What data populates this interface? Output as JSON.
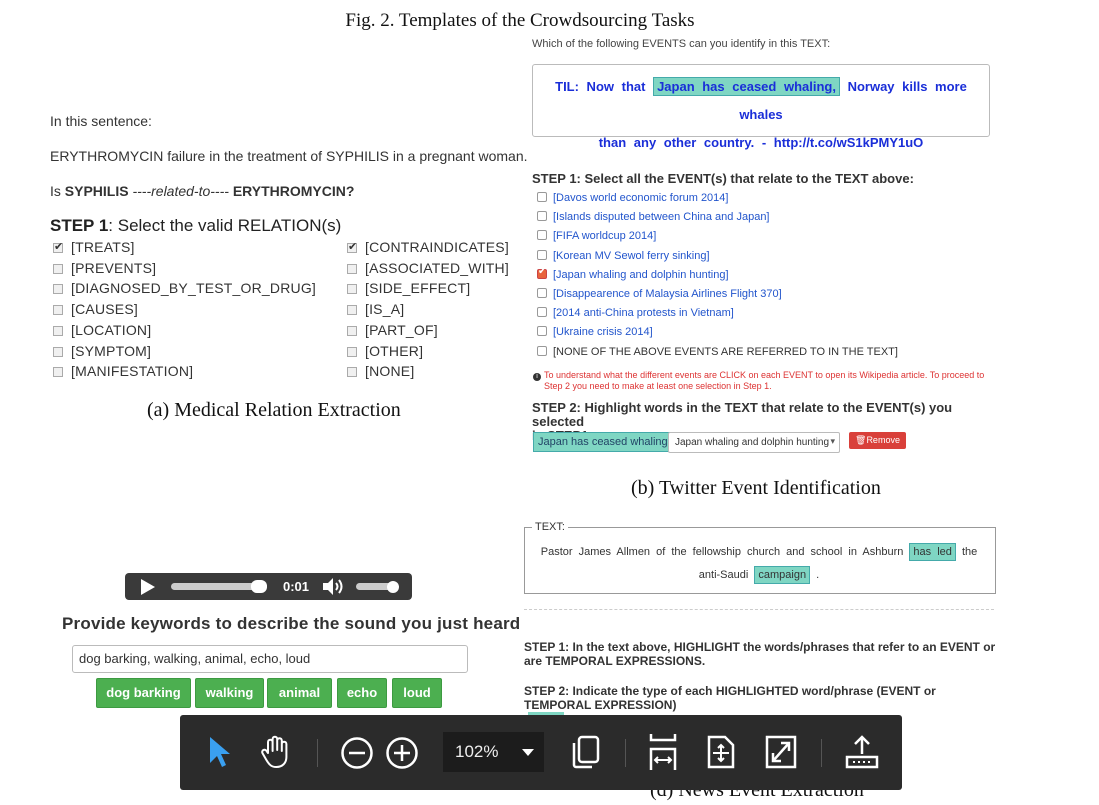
{
  "figure": {
    "title": "Fig. 2. Templates of the Crowdsourcing Tasks"
  },
  "panel_a": {
    "intro": "In this sentence:",
    "sentence": "ERYTHROMYCIN failure in the treatment of SYPHILIS in a pregnant woman.",
    "question_pre": "Is ",
    "term1": "SYPHILIS",
    "relation": " ----related-to---- ",
    "term2": "ERYTHROMYCIN?",
    "step_prefix": "STEP 1",
    "step_rest": ": Select the valid RELATION(s)",
    "left_options": [
      {
        "label": "[TREATS]",
        "checked": true
      },
      {
        "label": "[PREVENTS]",
        "checked": false
      },
      {
        "label": "[DIAGNOSED_BY_TEST_OR_DRUG]",
        "checked": false
      },
      {
        "label": "[CAUSES]",
        "checked": false
      },
      {
        "label": "[LOCATION]",
        "checked": false
      },
      {
        "label": "[SYMPTOM]",
        "checked": false
      },
      {
        "label": "[MANIFESTATION]",
        "checked": false
      }
    ],
    "right_options": [
      {
        "label": "[CONTRAINDICATES]",
        "checked": true
      },
      {
        "label": "[ASSOCIATED_WITH]",
        "checked": false
      },
      {
        "label": "[SIDE_EFFECT]",
        "checked": false
      },
      {
        "label": "[IS_A]",
        "checked": false
      },
      {
        "label": "[PART_OF]",
        "checked": false
      },
      {
        "label": "[OTHER]",
        "checked": false
      },
      {
        "label": "[NONE]",
        "checked": false
      }
    ],
    "caption": "(a) Medical Relation Extraction"
  },
  "panel_b": {
    "question": "Which of the following EVENTS can you identify in this TEXT:",
    "tweet_pre": "TIL: Now that ",
    "tweet_highlight": "Japan has ceased whaling,",
    "tweet_post1": " Norway kills more whales",
    "tweet_line2": "than any other country. - http://t.co/wS1kPMY1uO",
    "step1": "STEP 1: Select all the EVENT(s) that relate to the TEXT above:",
    "events": [
      {
        "label": "[Davos world economic forum 2014]",
        "checked": false
      },
      {
        "label": "[Islands disputed between China and Japan]",
        "checked": false
      },
      {
        "label": "[FIFA worldcup 2014]",
        "checked": false
      },
      {
        "label": "[Korean MV Sewol ferry sinking]",
        "checked": false
      },
      {
        "label": "[Japan whaling and dolphin hunting]",
        "checked": true
      },
      {
        "label": "[Disappearence of Malaysia Airlines Flight 370]",
        "checked": false
      },
      {
        "label": "[2014 anti-China protests in Vietnam]",
        "checked": false
      },
      {
        "label": "[Ukraine crisis 2014]",
        "checked": false
      },
      {
        "label": "[NONE OF THE ABOVE EVENTS ARE REFERRED TO IN THE TEXT]",
        "checked": false
      }
    ],
    "warning_line1": "To understand what the different events are CLICK on each EVENT to open its Wikipedia article. To proceed to",
    "warning_line2": "Step 2 you need to make at least one selection in Step 1.",
    "step2_line1": "STEP 2: Highlight words in the TEXT that relate to the EVENT(s) you selected",
    "step2_line2": "in STEP1",
    "chip": "Japan has ceased whaling,",
    "select_value": "Japan whaling and dolphin hunting",
    "remove_label": "Remove",
    "caption": "(b) Twitter Event Identification"
  },
  "panel_c": {
    "time": "0:01",
    "title": "Provide keywords to describe the sound you just heard",
    "input_value": "dog barking, walking, animal, echo, loud",
    "buttons": [
      "dog barking",
      "walking",
      "animal",
      "echo",
      "loud"
    ]
  },
  "panel_d": {
    "legend": "TEXT:",
    "line1_pre": "Pastor James Allmen of the fellowship church and school in Ashburn ",
    "line1_hl": "has led",
    "line1_post": " the",
    "line2_pre": "anti-Saudi ",
    "line2_hl": "campaign",
    "line2_post": " .",
    "step1_line1": "STEP 1: In the text above, HIGHLIGHT the words/phrases that refer to an EVENT or",
    "step1_line2": "are TEMPORAL EXPRESSIONS.",
    "step2_line1": "STEP 2: Indicate the type of each HIGHLIGHTED word/phrase (EVENT or",
    "step2_line2": "TEMPORAL EXPRESSION)",
    "caption": "(d) News Event Extraction"
  },
  "toolbar": {
    "zoom": "102%",
    "icons": [
      "select-pointer-icon",
      "hand-pan-icon",
      "zoom-out-icon",
      "zoom-in-icon",
      "copy-icon",
      "fit-width-icon",
      "fit-page-icon",
      "fullscreen-icon",
      "share-export-icon"
    ]
  }
}
